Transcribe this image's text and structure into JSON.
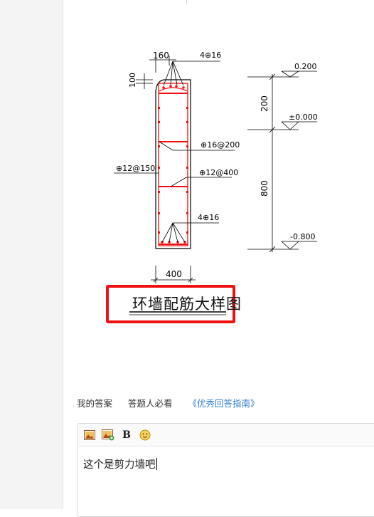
{
  "drawing": {
    "dims": {
      "top_width": "160",
      "cover": "100",
      "top_bars": "4⊕16",
      "stirrup_side": "⊕16@200",
      "stirrup_mid": "⊕12@400",
      "left_bars": "⊕12@150",
      "bottom_bars": "4⊕16",
      "section_width": "400",
      "height_upper": "200",
      "height_lower": "800"
    },
    "elevations": {
      "top": "0.200",
      "zero": "±0.000",
      "bottom": "-0.800"
    },
    "title": "环墙配筋大样图",
    "colors": {
      "rebar": "#ee1111",
      "highlight_box": "#ee1111"
    }
  },
  "answer_bar": {
    "my_answer": "我的答案",
    "must_read": "答题人必看",
    "guide_link": "《优秀回答指南》"
  },
  "editor": {
    "toolbar": {
      "image_icon": "image-icon",
      "insert_image_icon": "image-add-icon",
      "bold_label": "B",
      "emoji_icon": "emoji-icon"
    },
    "content": "这个是剪力墙吧"
  }
}
